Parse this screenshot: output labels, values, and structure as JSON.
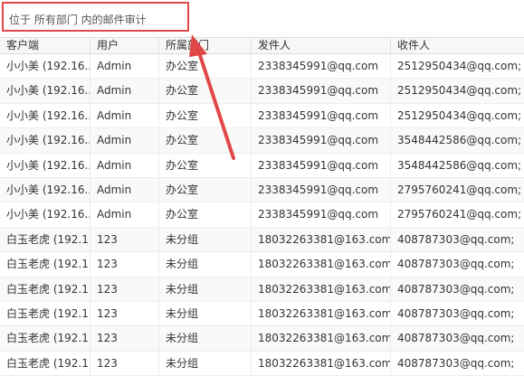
{
  "header": {
    "location_text": "位于 所有部门 内的邮件审计"
  },
  "table": {
    "columns": [
      "客户端",
      "用户",
      "所属部门",
      "发件人",
      "收件人"
    ],
    "rows": [
      [
        "小小美 (192.16...",
        "Admin",
        "办公室",
        "2338345991@qq.com",
        "2512950434@qq.com;"
      ],
      [
        "小小美 (192.16...",
        "Admin",
        "办公室",
        "2338345991@qq.com",
        "2512950434@qq.com;"
      ],
      [
        "小小美 (192.16...",
        "Admin",
        "办公室",
        "2338345991@qq.com",
        "2512950434@qq.com;"
      ],
      [
        "小小美 (192.16...",
        "Admin",
        "办公室",
        "2338345991@qq.com",
        "3548442586@qq.com;"
      ],
      [
        "小小美 (192.16...",
        "Admin",
        "办公室",
        "2338345991@qq.com",
        "3548442586@qq.com;"
      ],
      [
        "小小美 (192.16...",
        "Admin",
        "办公室",
        "2338345991@qq.com",
        "2795760241@qq.com;"
      ],
      [
        "小小美 (192.16...",
        "Admin",
        "办公室",
        "2338345991@qq.com",
        "2795760241@qq.com;"
      ],
      [
        "白玉老虎 (192.1...",
        "123",
        "未分组",
        "18032263381@163.com",
        "408787303@qq.com;"
      ],
      [
        "白玉老虎 (192.1...",
        "123",
        "未分组",
        "18032263381@163.com",
        "408787303@qq.com;"
      ],
      [
        "白玉老虎 (192.1...",
        "123",
        "未分组",
        "18032263381@163.com",
        "408787303@qq.com;"
      ],
      [
        "白玉老虎 (192.1...",
        "123",
        "未分组",
        "18032263381@163.com",
        "408787303@qq.com;"
      ],
      [
        "白玉老虎 (192.1...",
        "123",
        "未分组",
        "18032263381@163.com",
        "408787303@qq.com;"
      ],
      [
        "白玉老虎 (192.1...",
        "123",
        "未分组",
        "18032263381@163.com",
        "408787303@qq.com;"
      ]
    ]
  },
  "annotation": {
    "color": "#e04848"
  }
}
